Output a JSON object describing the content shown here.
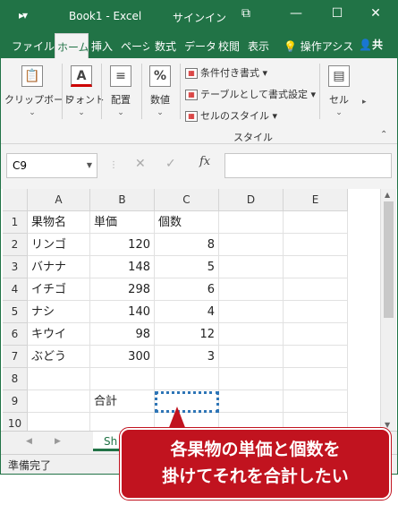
{
  "title_bar": {
    "quick_access": "▸▾",
    "title": "Book1 - Excel",
    "signin": "サインイン",
    "restore": "⧉",
    "minimize": "—",
    "maximize": "☐",
    "close": "✕"
  },
  "ribbon_tabs": [
    "ファイル",
    "ホーム",
    "挿入",
    "ページ",
    "数式",
    "データ",
    "校閲",
    "表示"
  ],
  "ribbon_extra": {
    "tell_me": "操作アシス",
    "share": "共"
  },
  "ribbon": {
    "clipboard": "クリップボード",
    "font": "フォント",
    "font_icon": "A",
    "alignment": "配置",
    "number": "数値",
    "number_icon": "%",
    "cond_format": "条件付き書式",
    "table_format": "テーブルとして書式設定",
    "cell_styles": "セルのスタイル",
    "styles_group": "スタイル",
    "cells": "セル"
  },
  "formula_bar": {
    "name_box": "C9",
    "fx": "fx",
    "cancel": "✕",
    "enter": "✓",
    "formula": ""
  },
  "columns": [
    "A",
    "B",
    "C",
    "D",
    "E"
  ],
  "rows": [
    {
      "n": "1",
      "a": "果物名",
      "b": "単価",
      "c": "個数"
    },
    {
      "n": "2",
      "a": "リンゴ",
      "b": "120",
      "c": "8"
    },
    {
      "n": "3",
      "a": "バナナ",
      "b": "148",
      "c": "5"
    },
    {
      "n": "4",
      "a": "イチゴ",
      "b": "298",
      "c": "6"
    },
    {
      "n": "5",
      "a": "ナシ",
      "b": "140",
      "c": "4"
    },
    {
      "n": "6",
      "a": "キウイ",
      "b": "98",
      "c": "12"
    },
    {
      "n": "7",
      "a": "ぶどう",
      "b": "300",
      "c": "3"
    },
    {
      "n": "8",
      "a": "",
      "b": "",
      "c": ""
    },
    {
      "n": "9",
      "a": "",
      "b": "合計",
      "c": ""
    },
    {
      "n": "10",
      "a": "",
      "b": "",
      "c": ""
    }
  ],
  "sheet_tab": "Sh",
  "status": "準備完了",
  "callout": {
    "line1": "各果物の単価と個数を",
    "line2": "掛けてそれを合計したい"
  }
}
